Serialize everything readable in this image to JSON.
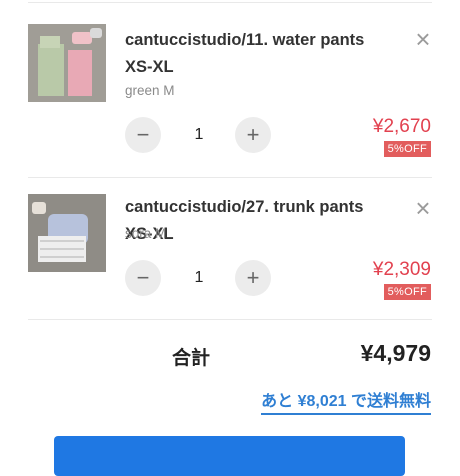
{
  "cart": {
    "items": [
      {
        "title": "cantuccistudio/11. water pants XS-XL",
        "variant": "green M",
        "quantity": "1",
        "price": "¥2,670",
        "discount": "5%OFF"
      },
      {
        "title": "cantuccistudio/27. trunk pants XS-XL",
        "variant": "sora M",
        "quantity": "1",
        "price": "¥2,309",
        "discount": "5%OFF"
      }
    ],
    "controls": {
      "minus": "−",
      "plus": "+",
      "remove": "×"
    },
    "total_label": "合計",
    "total_value": "¥4,979",
    "free_shipping_note": "あと ¥8,021 で送料無料"
  },
  "colors": {
    "price": "#e2414f",
    "discount_badge": "#e25d5d",
    "link": "#2f7fd3",
    "checkout_button": "#1f78e3"
  }
}
